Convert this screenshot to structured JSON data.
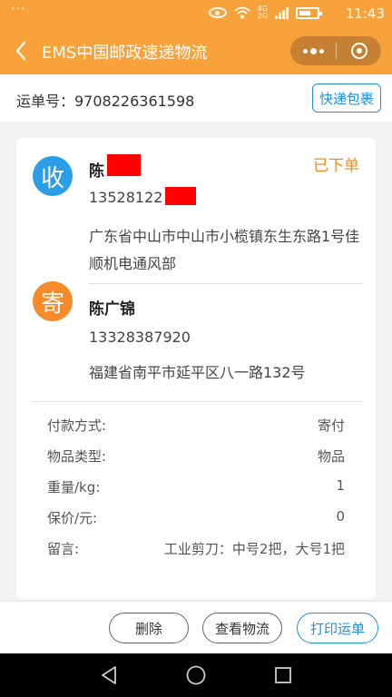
{
  "status_bar": {
    "dots": "···",
    "net_top": "4G",
    "net_bottom": "2G",
    "time": "11:43"
  },
  "nav": {
    "title": "EMS中国邮政速递物流",
    "back_icon": "chevron-left-icon",
    "more_icon": "more-dots-icon",
    "close_icon": "target-circle-icon"
  },
  "waybill": {
    "label": "运单号：9708226361598",
    "button": "快递包裹"
  },
  "receiver": {
    "badge": "收",
    "name_visible": "陈",
    "phone_visible": "13528122",
    "address": "广东省中山市中山市小榄镇东生东路1号佳顺机电通风部"
  },
  "order_status": "已下单",
  "sender": {
    "badge": "寄",
    "name": "陈广锦",
    "phone": "13328387920",
    "address": "福建省南平市延平区八一路132号"
  },
  "details": [
    {
      "key": "付款方式:",
      "value": "寄付"
    },
    {
      "key": "物品类型:",
      "value": "物品"
    },
    {
      "key": "重量/kg:",
      "value": "1"
    },
    {
      "key": "保价/元:",
      "value": "0"
    },
    {
      "key": "留言:",
      "value": "工业剪刀：中号2把，大号1把"
    }
  ],
  "actions": {
    "delete": "删除",
    "track": "查看物流",
    "print": "打印运单"
  },
  "colors": {
    "header": "#f7a23a",
    "accent_blue": "#1e90e0",
    "status_orange": "#f08c1f",
    "receiver_badge": "#2c9ee8",
    "sender_badge": "#f58a2a",
    "redaction": "#ff0000"
  }
}
